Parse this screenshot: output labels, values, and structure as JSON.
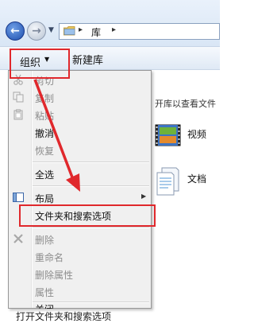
{
  "address_bar": {
    "crumb_separator": "▸",
    "location": "库"
  },
  "command_bar": {
    "organize_label": "组织",
    "organize_arrow": "▼",
    "new_library_label": "新建库"
  },
  "content": {
    "library_hint": "开库以查看文件",
    "items": [
      {
        "label": "视频",
        "icon": "video-library-icon"
      },
      {
        "label": "文档",
        "icon": "documents-library-icon"
      }
    ]
  },
  "menu": {
    "items": [
      {
        "label": "剪切",
        "enabled": false,
        "icon": "scissors-icon"
      },
      {
        "label": "复制",
        "enabled": false,
        "icon": "copy-icon"
      },
      {
        "label": "粘贴",
        "enabled": false,
        "icon": "paste-icon"
      },
      {
        "label": "撤消",
        "enabled": true
      },
      {
        "label": "恢复",
        "enabled": false
      },
      {
        "label": "全选",
        "enabled": true
      },
      {
        "label": "布局",
        "enabled": true,
        "submenu": true,
        "icon": "layout-icon"
      },
      {
        "label": "文件夹和搜索选项",
        "enabled": true,
        "highlighted_annotation": true
      },
      {
        "label": "删除",
        "enabled": false,
        "icon": "delete-x-icon"
      },
      {
        "label": "重命名",
        "enabled": false
      },
      {
        "label": "删除属性",
        "enabled": false
      },
      {
        "label": "属性",
        "enabled": false
      },
      {
        "label": "关闭",
        "enabled": true
      }
    ],
    "submenu_arrow": "▶"
  },
  "annotation": {
    "color": "#e0282c"
  },
  "caption": "打开文件夹和搜索选项"
}
